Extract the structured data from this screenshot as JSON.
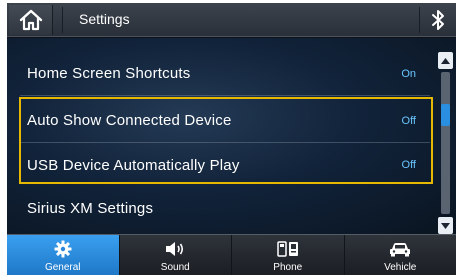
{
  "header": {
    "title": "Settings"
  },
  "settings": {
    "items": [
      {
        "label": "Home Screen Shortcuts",
        "value": "On"
      },
      {
        "label": "Auto Show Connected Device",
        "value": "Off"
      },
      {
        "label": "USB Device Automatically Play",
        "value": "Off"
      },
      {
        "label": "Sirius XM Settings",
        "value": ""
      }
    ]
  },
  "tabs": [
    {
      "label": "General",
      "icon": "gear-icon",
      "active": true
    },
    {
      "label": "Sound",
      "icon": "speaker-icon",
      "active": false
    },
    {
      "label": "Phone",
      "icon": "phone-icon",
      "active": false
    },
    {
      "label": "Vehicle",
      "icon": "car-icon",
      "active": false
    }
  ],
  "colors": {
    "accent": "#2a8fe0",
    "highlight": "#e6b800",
    "value_text": "#69c6ff"
  }
}
